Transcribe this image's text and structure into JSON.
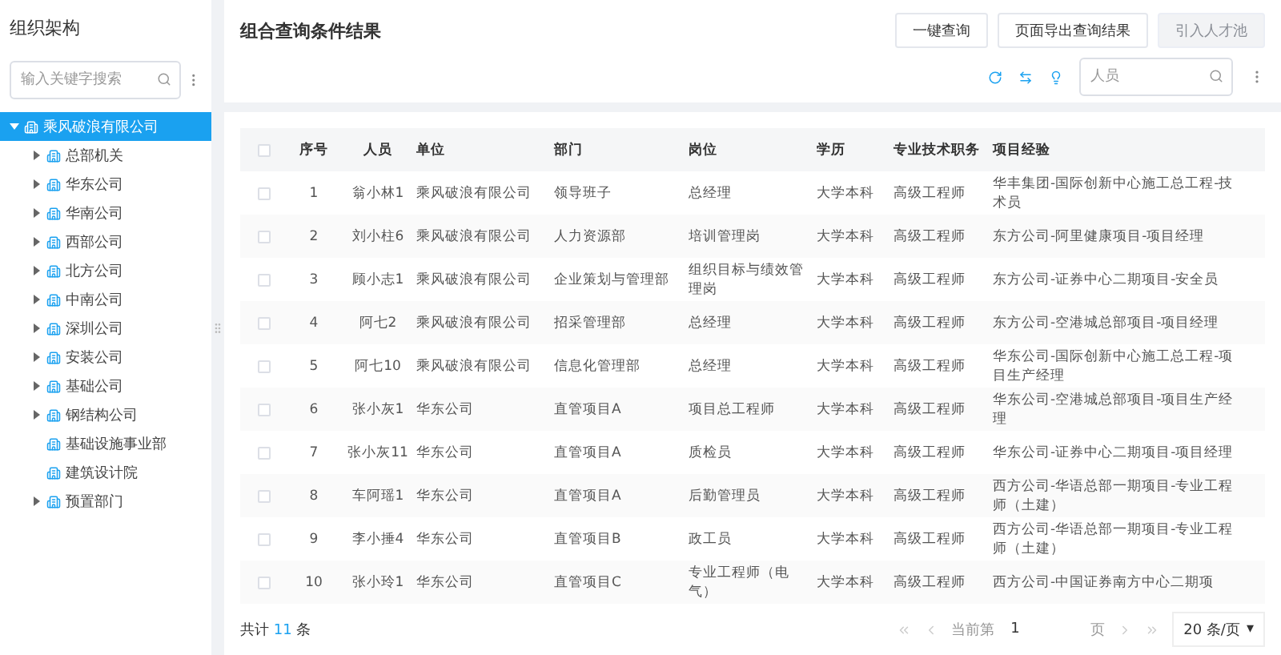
{
  "sidebar": {
    "title": "组织架构",
    "search": {
      "placeholder": "输入关键字搜索"
    },
    "tree": [
      {
        "label": "乘风破浪有限公司",
        "selected": true,
        "expanded": true,
        "children": [
          {
            "label": "总部机关",
            "selected": false,
            "expanded": false,
            "has_children": true
          },
          {
            "label": "华东公司",
            "selected": false,
            "expanded": false,
            "has_children": true
          },
          {
            "label": "华南公司",
            "selected": false,
            "expanded": false,
            "has_children": true
          },
          {
            "label": "西部公司",
            "selected": false,
            "expanded": false,
            "has_children": true
          },
          {
            "label": "北方公司",
            "selected": false,
            "expanded": false,
            "has_children": true
          },
          {
            "label": "中南公司",
            "selected": false,
            "expanded": false,
            "has_children": true
          },
          {
            "label": "深圳公司",
            "selected": false,
            "expanded": false,
            "has_children": true
          },
          {
            "label": "安装公司",
            "selected": false,
            "expanded": false,
            "has_children": true
          },
          {
            "label": "基础公司",
            "selected": false,
            "expanded": false,
            "has_children": true
          },
          {
            "label": "钢结构公司",
            "selected": false,
            "expanded": false,
            "has_children": true
          },
          {
            "label": "基础设施事业部",
            "selected": false,
            "expanded": false,
            "has_children": false
          },
          {
            "label": "建筑设计院",
            "selected": false,
            "expanded": false,
            "has_children": false
          },
          {
            "label": "预置部门",
            "selected": false,
            "expanded": false,
            "has_children": true
          }
        ]
      }
    ]
  },
  "main": {
    "title": "组合查询条件结果",
    "buttons": [
      {
        "label": "一键查询",
        "disabled": false
      },
      {
        "label": "页面导出查询结果",
        "disabled": false
      },
      {
        "label": "引入人才池",
        "disabled": true
      }
    ],
    "search": {
      "placeholder": "人员"
    },
    "table": {
      "select_all": {
        "checked": false
      },
      "columns": [
        "序号",
        "人员",
        "单位",
        "部门",
        "岗位",
        "学历",
        "专业技术职务",
        "项目经验"
      ],
      "rows": [
        {
          "checked": false,
          "cells": [
            "1",
            "翁小林1",
            "乘风破浪有限公司",
            "领导班子",
            "总经理",
            "大学本科",
            "高级工程师",
            "华丰集团-国际创新中心施工总工程-技术员"
          ]
        },
        {
          "checked": false,
          "cells": [
            "2",
            "刘小柱6",
            "乘风破浪有限公司",
            "人力资源部",
            "培训管理岗",
            "大学本科",
            "高级工程师",
            "东方公司-阿里健康项目-项目经理"
          ]
        },
        {
          "checked": false,
          "cells": [
            "3",
            "顾小志1",
            "乘风破浪有限公司",
            "企业策划与管理部",
            "组织目标与绩效管理岗",
            "大学本科",
            "高级工程师",
            "东方公司-证券中心二期项目-安全员"
          ]
        },
        {
          "checked": false,
          "cells": [
            "4",
            "阿七2",
            "乘风破浪有限公司",
            "招采管理部",
            "总经理",
            "大学本科",
            "高级工程师",
            "东方公司-空港城总部项目-项目经理"
          ]
        },
        {
          "checked": false,
          "cells": [
            "5",
            "阿七10",
            "乘风破浪有限公司",
            "信息化管理部",
            "总经理",
            "大学本科",
            "高级工程师",
            "华东公司-国际创新中心施工总工程-项目生产经理"
          ]
        },
        {
          "checked": false,
          "cells": [
            "6",
            "张小灰1",
            "华东公司",
            "直管项目A",
            "项目总工程师",
            "大学本科",
            "高级工程师",
            "华东公司-空港城总部项目-项目生产经理"
          ]
        },
        {
          "checked": false,
          "cells": [
            "7",
            "张小灰11",
            "华东公司",
            "直管项目A",
            "质检员",
            "大学本科",
            "高级工程师",
            "华东公司-证券中心二期项目-项目经理"
          ]
        },
        {
          "checked": false,
          "cells": [
            "8",
            "车阿瑶1",
            "华东公司",
            "直管项目A",
            "后勤管理员",
            "大学本科",
            "高级工程师",
            "西方公司-华语总部一期项目-专业工程师（土建）"
          ]
        },
        {
          "checked": false,
          "cells": [
            "9",
            "李小捶4",
            "华东公司",
            "直管项目B",
            "政工员",
            "大学本科",
            "高级工程师",
            "西方公司-华语总部一期项目-专业工程师（土建）"
          ]
        },
        {
          "checked": false,
          "cells": [
            "10",
            "张小玲1",
            "华东公司",
            "直管项目C",
            "专业工程师（电气）",
            "大学本科",
            "高级工程师",
            "西方公司-中国证券南方中心二期项"
          ]
        }
      ]
    },
    "footer": {
      "total": "共计 **11** 条",
      "page_label_before": "当前第",
      "page": "1",
      "page_label_after": "页",
      "page_size": "20 条/页",
      "page_size_caret": "▾"
    }
  }
}
